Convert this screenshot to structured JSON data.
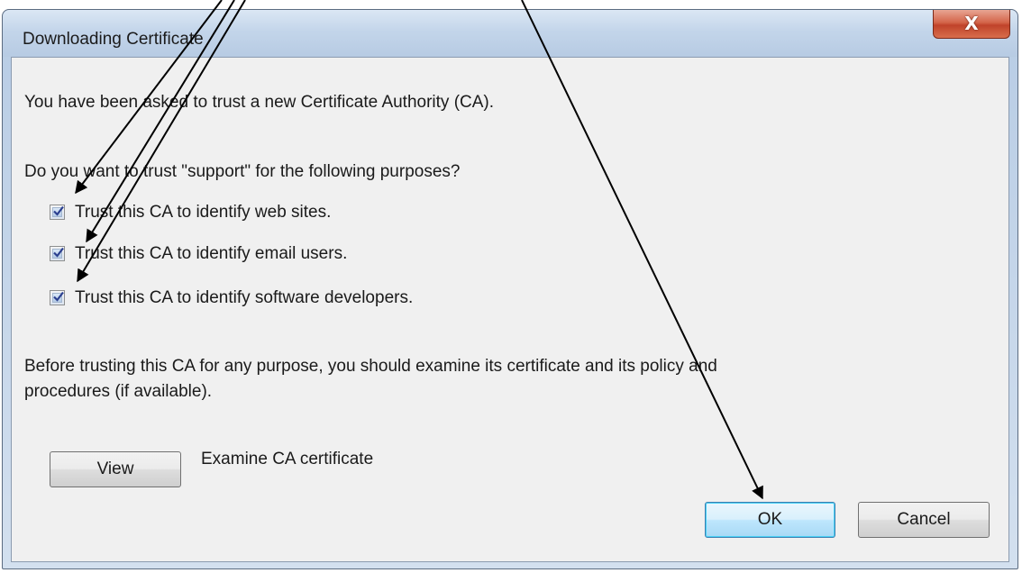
{
  "dialog": {
    "title": "Downloading Certificate",
    "close_label": "X"
  },
  "content": {
    "intro": "You have been asked to trust a new Certificate Authority (CA).",
    "question": "Do you want to trust \"support\" for the following purposes?",
    "options": [
      {
        "label": "Trust this CA to identify web sites.",
        "checked": true
      },
      {
        "label": "Trust this CA to identify email users.",
        "checked": true
      },
      {
        "label": "Trust this CA to identify software developers.",
        "checked": true
      }
    ],
    "advice_line1": "Before trusting this CA for any purpose, you should examine its certificate and its policy and",
    "advice_line2": "procedures (if available).",
    "view_button": "View",
    "view_description": "Examine CA certificate"
  },
  "buttons": {
    "ok": "OK",
    "cancel": "Cancel"
  },
  "colors": {
    "client_bg": "#f0f0f0",
    "close_button": "#c0432a",
    "default_button_border": "#3c7fb1",
    "arrow": "#000000"
  }
}
